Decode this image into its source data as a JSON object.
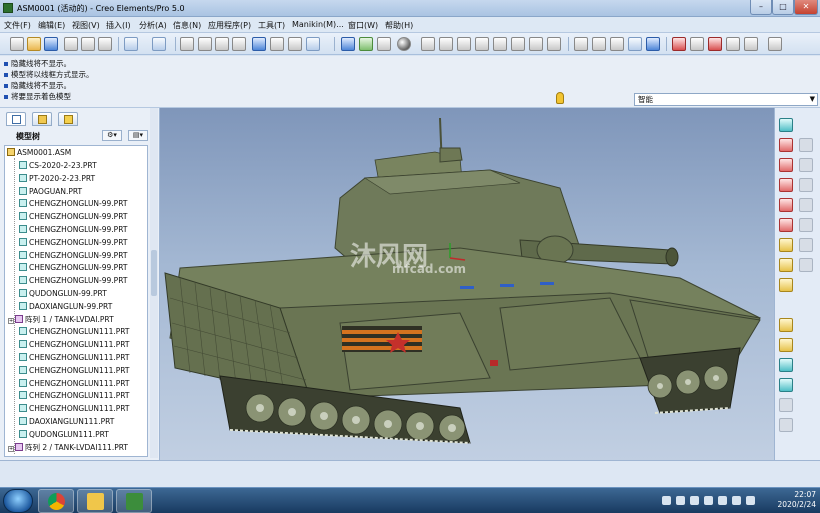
{
  "window": {
    "title": "ASM0001 (活动的) - Creo Elements/Pro 5.0",
    "controls": {
      "minimize": "–",
      "maximize": "□",
      "close": "✕"
    }
  },
  "menubar": {
    "items": [
      "文件(F)",
      "编辑(E)",
      "视图(V)",
      "插入(I)",
      "分析(A)",
      "信息(N)",
      "应用程序(P)",
      "工具(T)",
      "Manikin(M)...",
      "窗口(W)",
      "帮助(H)"
    ]
  },
  "toolbar": {
    "icons": [
      "new-icon",
      "open-icon",
      "save-icon",
      "print-icon",
      "email-icon",
      "undo-icon",
      "redo-icon",
      "cut-icon",
      "copy-icon",
      "paste-icon",
      "regenerate-icon",
      "find-icon",
      "select-box-icon",
      "repaint-icon",
      "spin-center-icon",
      "shading-icon",
      "orient-icon",
      "zoom-in-icon",
      "zoom-out-icon",
      "refit-icon",
      "saved-views-icon",
      "layers-icon",
      "wireframe-icon",
      "hidden-line-icon",
      "no-hidden-icon",
      "shaded-icon",
      "display-style-icon",
      "datum-planes-icon",
      "datum-axes-icon",
      "datum-points-icon",
      "coordinate-systems-icon",
      "annotation-icon",
      "context-help-icon"
    ]
  },
  "messages": [
    "隐藏线将不显示。",
    "模型将以线框方式显示。",
    "隐藏线将不显示。",
    "将要显示着色模型"
  ],
  "filter": {
    "value": "智能"
  },
  "panel": {
    "tabs": [
      "model-tree-tab",
      "folder-browser-tab",
      "favorites-tab"
    ],
    "header": "模型树",
    "header_buttons": {
      "settings": "⚙▾",
      "show": "▤▾"
    }
  },
  "tree": {
    "root": "ASM0001.ASM",
    "items": [
      {
        "label": "CS-2020-2-23.PRT",
        "type": "part",
        "expandable": false
      },
      {
        "label": "PT-2020-2-23.PRT",
        "type": "part",
        "expandable": false
      },
      {
        "label": "PAOGUAN.PRT",
        "type": "part",
        "expandable": false
      },
      {
        "label": "CHENGZHONGLUN-99.PRT",
        "type": "part",
        "expandable": false
      },
      {
        "label": "CHENGZHONGLUN-99.PRT",
        "type": "part",
        "expandable": false
      },
      {
        "label": "CHENGZHONGLUN-99.PRT",
        "type": "part",
        "expandable": false
      },
      {
        "label": "CHENGZHONGLUN-99.PRT",
        "type": "part",
        "expandable": false
      },
      {
        "label": "CHENGZHONGLUN-99.PRT",
        "type": "part",
        "expandable": false
      },
      {
        "label": "CHENGZHONGLUN-99.PRT",
        "type": "part",
        "expandable": false
      },
      {
        "label": "CHENGZHONGLUN-99.PRT",
        "type": "part",
        "expandable": false
      },
      {
        "label": "QUDONGLUN-99.PRT",
        "type": "part",
        "expandable": false
      },
      {
        "label": "DAOXIANGLUN-99.PRT",
        "type": "part",
        "expandable": false
      },
      {
        "label": "阵列 1 / TANK-LVDAI.PRT",
        "type": "pattern",
        "expandable": true
      },
      {
        "label": "CHENGZHONGLUN111.PRT",
        "type": "part",
        "expandable": false
      },
      {
        "label": "CHENGZHONGLUN111.PRT",
        "type": "part",
        "expandable": false
      },
      {
        "label": "CHENGZHONGLUN111.PRT",
        "type": "part",
        "expandable": false
      },
      {
        "label": "CHENGZHONGLUN111.PRT",
        "type": "part",
        "expandable": false
      },
      {
        "label": "CHENGZHONGLUN111.PRT",
        "type": "part",
        "expandable": false
      },
      {
        "label": "CHENGZHONGLUN111.PRT",
        "type": "part",
        "expandable": false
      },
      {
        "label": "CHENGZHONGLUN111.PRT",
        "type": "part",
        "expandable": false
      },
      {
        "label": "DAOXIANGLUN111.PRT",
        "type": "part",
        "expandable": false
      },
      {
        "label": "QUDONGLUN111.PRT",
        "type": "part",
        "expandable": false
      },
      {
        "label": "阵列 2 / TANK-LVDAI111.PRT",
        "type": "pattern",
        "expandable": true
      }
    ]
  },
  "viewport": {
    "watermark": "沐风网",
    "watermark_url": "mfcad.com"
  },
  "right_toolbar": {
    "icons": [
      "sketch-icon",
      "plane-icon",
      "axis-icon",
      "curve-icon",
      "point-icon",
      "csys-icon",
      "analysis-icon",
      "mirror-icon",
      "extrude-icon",
      "revolve-icon",
      "sweep-icon",
      "blend-icon",
      "hole-icon",
      "round-icon",
      "chamfer-icon",
      "rib-icon",
      "shell-icon",
      "draft-icon"
    ]
  },
  "taskbar": {
    "apps": [
      "windows-start-icon",
      "chrome-icon",
      "file-explorer-icon",
      "creo-icon"
    ],
    "time": "22:07",
    "date": "2020/2/24"
  },
  "colors": {
    "viewport_top": "#7f96ba",
    "viewport_bottom": "#c1cfe2",
    "tank_body": "#6f7a5a",
    "tank_dark": "#3f4632",
    "stripe_orange": "#d4731f"
  }
}
